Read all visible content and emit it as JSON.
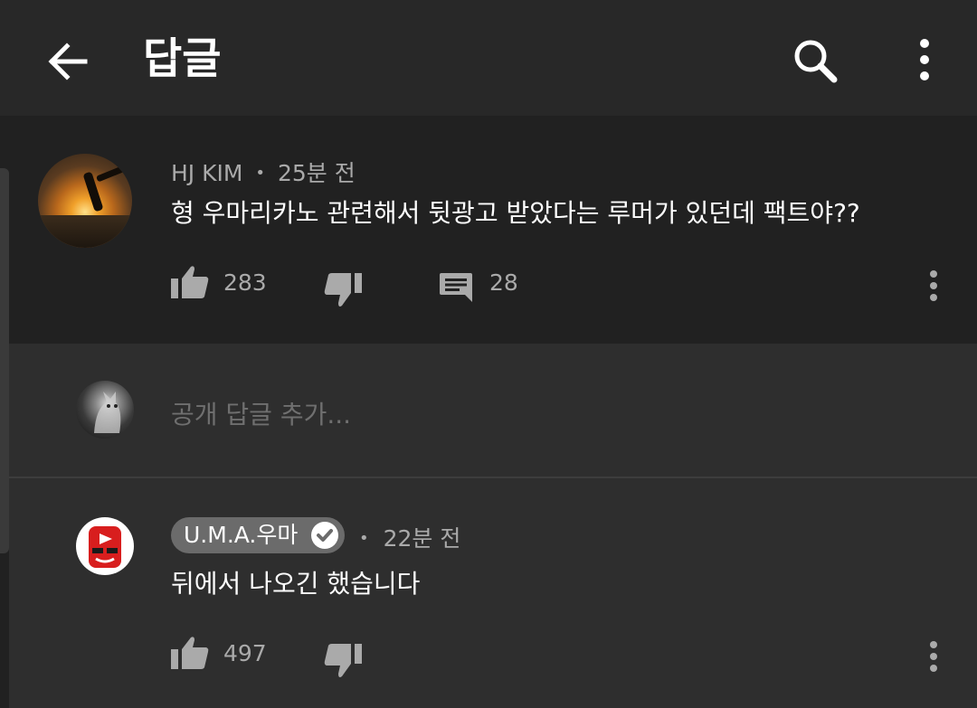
{
  "header": {
    "title": "답글",
    "back_icon": "arrow-left-icon",
    "search_icon": "search-icon",
    "more_icon": "more-vertical-icon"
  },
  "top_comment": {
    "author": "HJ KIM",
    "separator": "•",
    "time": "25분 전",
    "text": "형 우마리카노 관련해서 뒷광고 받았다는 루머가 있던데 팩트야??",
    "likes": "283",
    "replies": "28"
  },
  "reply_input": {
    "placeholder": "공개 답글 추가..."
  },
  "reply": {
    "author": "U.M.A.우마",
    "separator": "•",
    "time": "22분 전",
    "text": "뒤에서 나오긴 했습니다",
    "likes": "497"
  },
  "colors": {
    "header_bg": "#282828",
    "background": "#212121",
    "reply_bg": "#2e2e2e",
    "secondary_text": "#aaaaaa",
    "chip_bg": "#6b6b6b"
  }
}
